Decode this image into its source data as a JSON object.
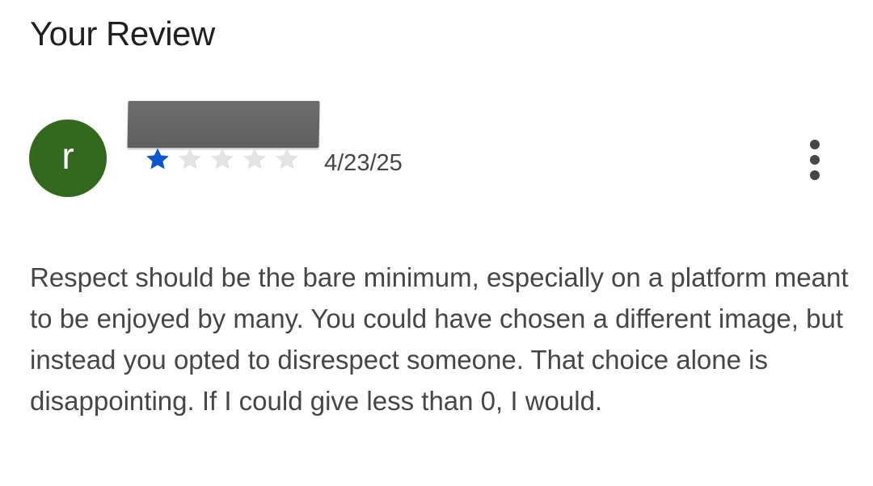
{
  "page": {
    "title": "Your Review"
  },
  "review": {
    "avatar_letter": "r",
    "avatar_color": "#33691e",
    "rating": 1,
    "max_rating": 5,
    "star_filled_color": "#0b57d0",
    "star_empty_color": "#e3e3e3",
    "date": "4/23/25",
    "more_icon": "more-vert-icon",
    "text": "Respect should be the bare minimum, especially on a platform meant to be enjoyed by many. You could have chosen a different image, but instead you opted to disrespect someone. That choice alone is disappointing. If I could give less than 0, I would."
  }
}
